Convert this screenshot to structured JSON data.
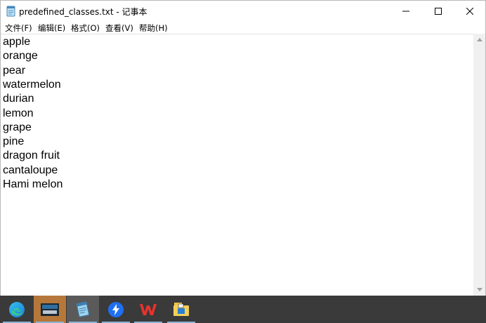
{
  "window": {
    "title": "predefined_classes.txt - 记事本"
  },
  "menu": {
    "items": [
      {
        "label": "文件(F)"
      },
      {
        "label": "编辑(E)"
      },
      {
        "label": "格式(O)"
      },
      {
        "label": "查看(V)"
      },
      {
        "label": "帮助(H)"
      }
    ]
  },
  "editor": {
    "lines": [
      "apple",
      "orange",
      "pear",
      "watermelon",
      "durian",
      "lemon",
      "grape",
      "pine",
      "dragon fruit",
      "cantaloupe",
      "Hami melon"
    ]
  },
  "taskbar": {
    "apps": [
      {
        "icon": "edge-icon"
      },
      {
        "icon": "photo-app-icon"
      },
      {
        "icon": "notepad-icon"
      },
      {
        "icon": "feishu-icon"
      },
      {
        "icon": "wps-office-icon"
      },
      {
        "icon": "file-explorer-icon"
      }
    ]
  },
  "colors": {
    "taskbar_bg": "#3a3a3a",
    "active_indicator": "#8ab4d8"
  }
}
